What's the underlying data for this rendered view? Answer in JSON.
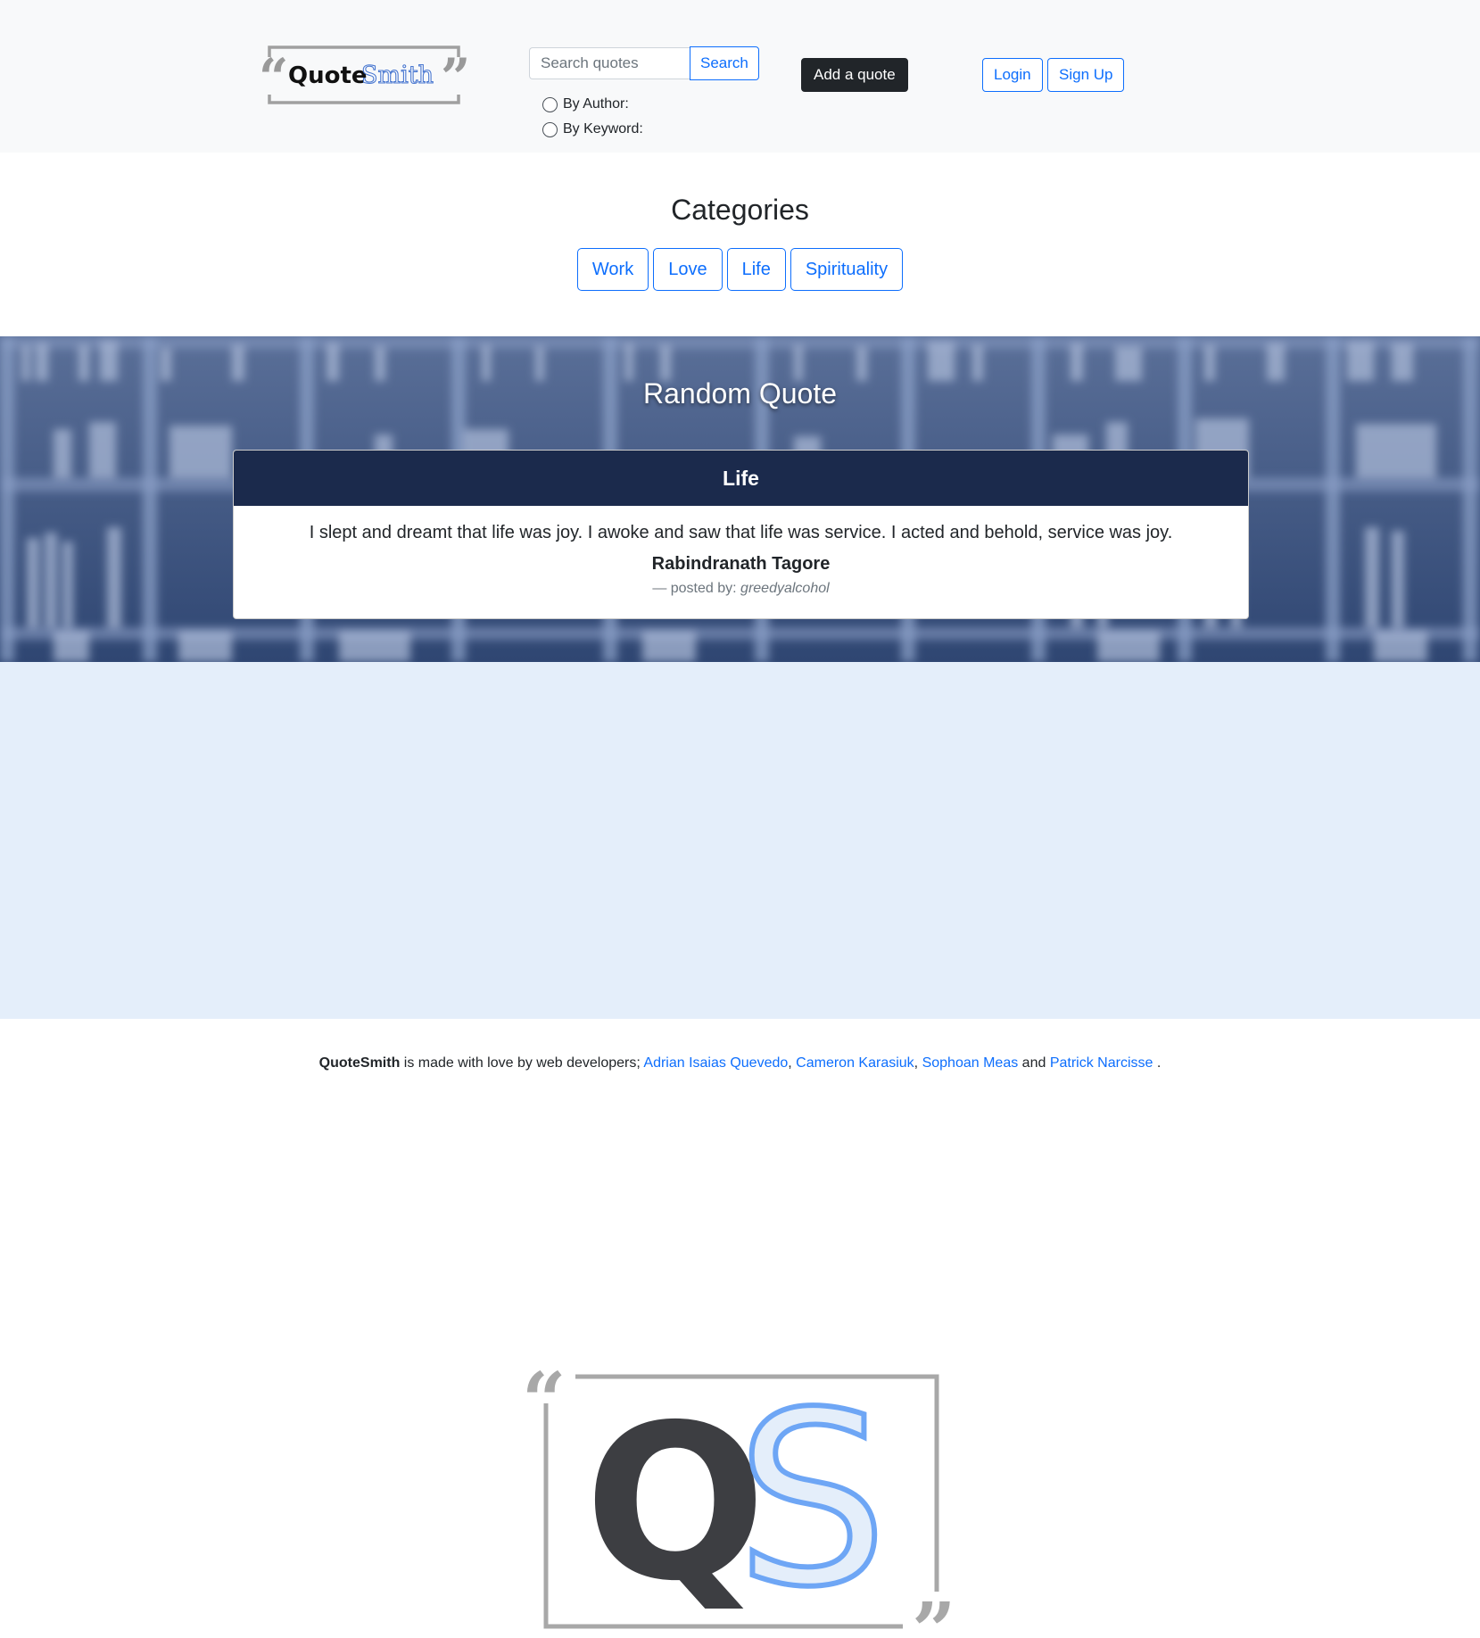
{
  "brand": {
    "word1": "Quote",
    "word2": "Smith"
  },
  "search": {
    "placeholder": "Search quotes",
    "button_label": "Search",
    "options": [
      "By Author:",
      "By Keyword:"
    ]
  },
  "nav": {
    "add_quote_label": "Add a quote",
    "login_label": "Login",
    "signup_label": "Sign Up"
  },
  "categories": {
    "title": "Categories",
    "items": [
      "Work",
      "Love",
      "Life",
      "Spirituality"
    ]
  },
  "random_quote": {
    "title": "Random Quote",
    "category": "Life",
    "text": "I slept and dreamt that life was joy. I awoke and saw that life was service. I acted and behold, service was joy.",
    "author": "Rabindranath Tagore",
    "posted_prefix": "— posted by:",
    "posted_user": "greedyalcohol"
  },
  "hero_logo": {
    "letter1": "Q",
    "letter2": "S"
  },
  "footer": {
    "brand": "QuoteSmith",
    "made_with": "is made with love by web developers;",
    "developers": [
      "Adrian Isaias Quevedo",
      "Cameron Karasiuk",
      "Sophoan Meas",
      "Patrick Narcisse"
    ],
    "sep1": ",",
    "sep2": ",",
    "and": "and",
    "end": "."
  },
  "colors": {
    "primary": "#0d6efd",
    "navbar_bg": "#f8f9fa",
    "dark_button": "#212529",
    "card_header": "#1b2a4c",
    "hero_bg": "#e4eefa",
    "logo_blue": "#6ea6f5",
    "logo_dark": "#3d3e42",
    "logo_gray": "#a8a8a8"
  }
}
